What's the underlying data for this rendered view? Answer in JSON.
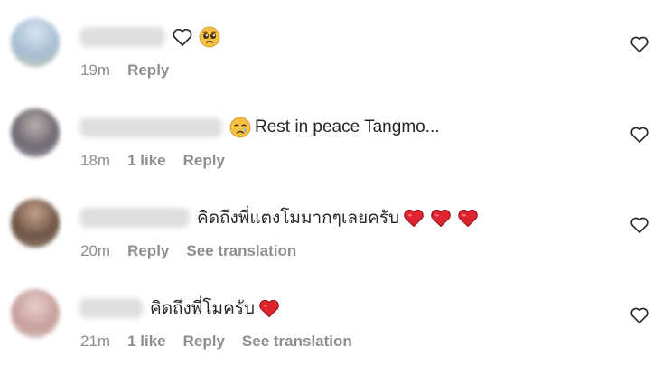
{
  "comments": [
    {
      "avatar_color": "#9fb3c8",
      "text": "",
      "emojis": [
        "heart-outline",
        "pleading-face"
      ],
      "time": "19m",
      "likes": "",
      "reply": "Reply",
      "translation": ""
    },
    {
      "avatar_color": "#8c8a92",
      "text": "Rest in peace Tangmo...",
      "emojis": [
        "crying-face"
      ],
      "time": "18m",
      "likes": "1 like",
      "reply": "Reply",
      "translation": ""
    },
    {
      "avatar_color": "#7a6557",
      "text": "คิดถึงพี่แตงโมมากๆเลยครับ",
      "emojis": [
        "red-heart",
        "red-heart",
        "red-heart"
      ],
      "time": "20m",
      "likes": "",
      "reply": "Reply",
      "translation": "See translation"
    },
    {
      "avatar_color": "#c9a7a5",
      "text": "คิดถึงพี่โมครับ",
      "emojis": [
        "red-heart"
      ],
      "time": "21m",
      "likes": "1 like",
      "reply": "Reply",
      "translation": "See translation"
    }
  ],
  "colors": {
    "meta_gray": "#8e8e8e",
    "text": "#262626",
    "heart_red": "#e0242f"
  }
}
